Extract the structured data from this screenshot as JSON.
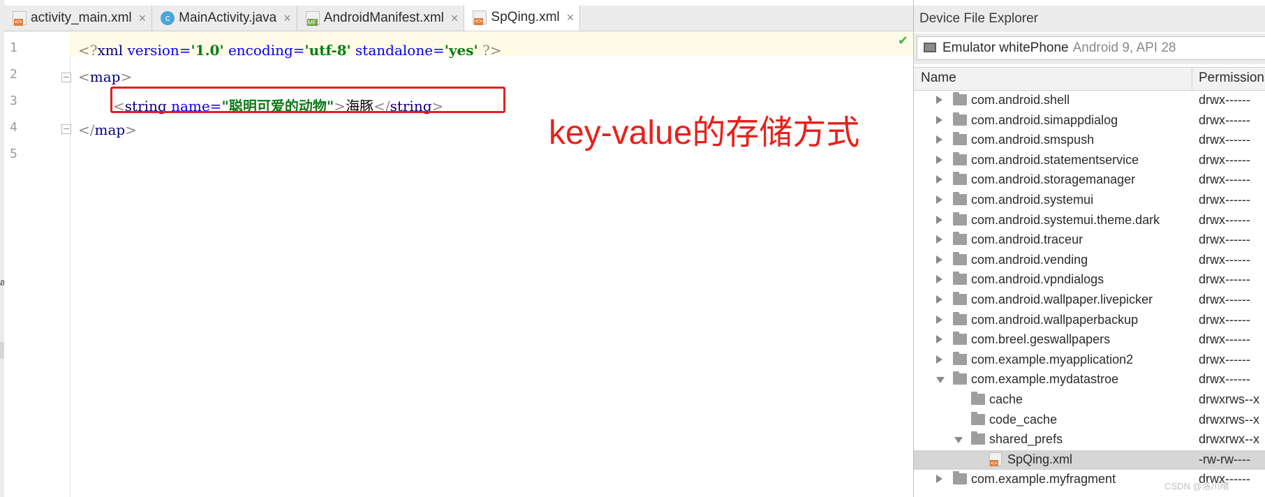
{
  "tabs": [
    {
      "label": "activity_main.xml",
      "icon": "xml-file-icon",
      "close": "×",
      "active": false
    },
    {
      "label": "MainActivity.java",
      "icon": "java-class-icon",
      "close": "×",
      "active": false
    },
    {
      "label": "AndroidManifest.xml",
      "icon": "manifest-file-icon",
      "close": "×",
      "active": false
    },
    {
      "label": "SpQing.xml",
      "icon": "xml-file-icon",
      "close": "×",
      "active": true
    }
  ],
  "java_icon_letter": "c",
  "editor": {
    "line_numbers": [
      "1",
      "2",
      "3",
      "4",
      "5"
    ],
    "line1": {
      "open": "<?",
      "tag": "xml",
      "attr1": "version=",
      "val1": "'1.0'",
      "attr2": "encoding=",
      "val2": "'utf-8'",
      "attr3": "standalone=",
      "val3": "'yes'",
      "close": "?>"
    },
    "line2": {
      "lt": "<",
      "tag": "map",
      "gt": ">"
    },
    "line3": {
      "lt": "<",
      "tag": "string",
      "attr": "name=",
      "val": "\"聪明可爱的动物\"",
      "gt": ">",
      "text": "海豚",
      "close_lt": "</",
      "close_tag": "string",
      "close_gt": ">"
    },
    "line4": {
      "lt": "</",
      "tag": "map",
      "gt": ">"
    },
    "check_glyph": "✔",
    "annotation": "key-value的存储方式"
  },
  "left_strip_glyph": "a",
  "explorer": {
    "title": "Device File Explorer",
    "device_name": "Emulator whitePhone",
    "device_info": "Android 9, API 28",
    "col_name": "Name",
    "col_permissions": "Permissions",
    "rows": [
      {
        "name": "com.android.shell",
        "perm": "drwx------",
        "type": "folder",
        "level": 0,
        "expand": "closed"
      },
      {
        "name": "com.android.simappdialog",
        "perm": "drwx------",
        "type": "folder",
        "level": 0,
        "expand": "closed"
      },
      {
        "name": "com.android.smspush",
        "perm": "drwx------",
        "type": "folder",
        "level": 0,
        "expand": "closed"
      },
      {
        "name": "com.android.statementservice",
        "perm": "drwx------",
        "type": "folder",
        "level": 0,
        "expand": "closed"
      },
      {
        "name": "com.android.storagemanager",
        "perm": "drwx------",
        "type": "folder",
        "level": 0,
        "expand": "closed"
      },
      {
        "name": "com.android.systemui",
        "perm": "drwx------",
        "type": "folder",
        "level": 0,
        "expand": "closed"
      },
      {
        "name": "com.android.systemui.theme.dark",
        "perm": "drwx------",
        "type": "folder",
        "level": 0,
        "expand": "closed"
      },
      {
        "name": "com.android.traceur",
        "perm": "drwx------",
        "type": "folder",
        "level": 0,
        "expand": "closed"
      },
      {
        "name": "com.android.vending",
        "perm": "drwx------",
        "type": "folder",
        "level": 0,
        "expand": "closed"
      },
      {
        "name": "com.android.vpndialogs",
        "perm": "drwx------",
        "type": "folder",
        "level": 0,
        "expand": "closed"
      },
      {
        "name": "com.android.wallpaper.livepicker",
        "perm": "drwx------",
        "type": "folder",
        "level": 0,
        "expand": "closed"
      },
      {
        "name": "com.android.wallpaperbackup",
        "perm": "drwx------",
        "type": "folder",
        "level": 0,
        "expand": "closed"
      },
      {
        "name": "com.breel.geswallpapers",
        "perm": "drwx------",
        "type": "folder",
        "level": 0,
        "expand": "closed"
      },
      {
        "name": "com.example.myapplication2",
        "perm": "drwx------",
        "type": "folder",
        "level": 0,
        "expand": "closed"
      },
      {
        "name": "com.example.mydatastroe",
        "perm": "drwx------",
        "type": "folder",
        "level": 0,
        "expand": "open"
      },
      {
        "name": "cache",
        "perm": "drwxrws--x",
        "type": "folder",
        "level": 1,
        "expand": "none"
      },
      {
        "name": "code_cache",
        "perm": "drwxrws--x",
        "type": "folder",
        "level": 1,
        "expand": "none"
      },
      {
        "name": "shared_prefs",
        "perm": "drwxrwx--x",
        "type": "folder",
        "level": 1,
        "expand": "open"
      },
      {
        "name": "SpQing.xml",
        "perm": "-rw-rw----",
        "type": "xml",
        "level": 2,
        "expand": "none",
        "selected": true
      },
      {
        "name": "com.example.myfragment",
        "perm": "drwx------",
        "type": "folder",
        "level": 0,
        "expand": "closed"
      }
    ]
  },
  "watermark": "CSDN @洛川晴"
}
